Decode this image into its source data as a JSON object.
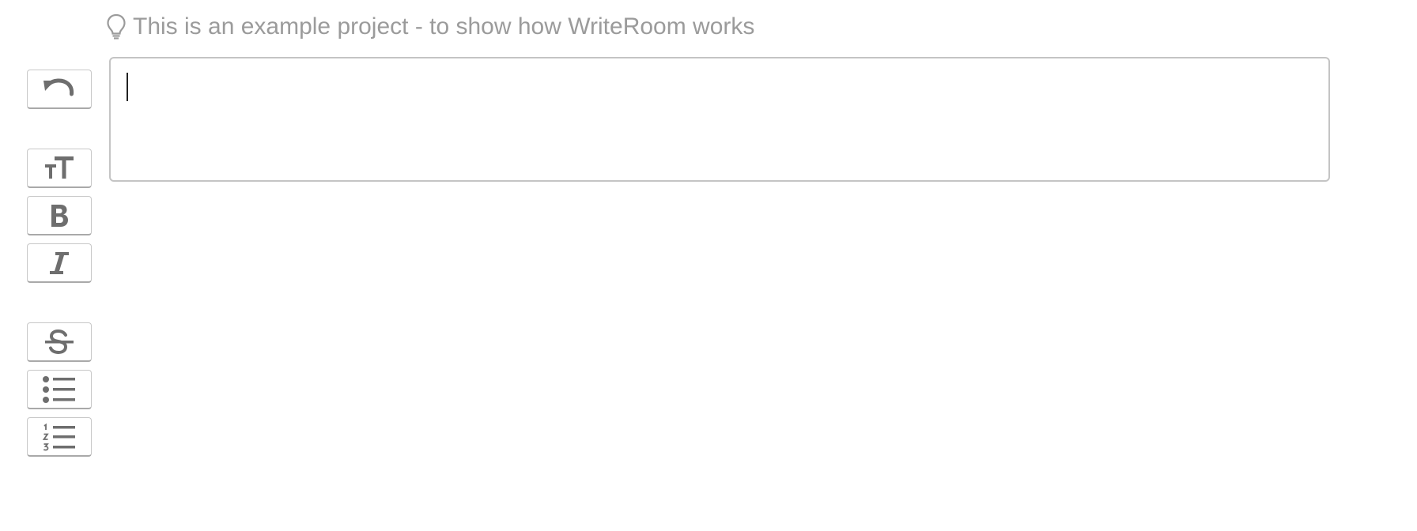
{
  "hint": {
    "icon": "lightbulb-icon",
    "text": "This is an example project - to show how WriteRoom works"
  },
  "editor": {
    "value": ""
  },
  "toolbar": {
    "buttons": [
      {
        "name": "undo-button",
        "icon": "undo-icon"
      },
      {
        "name": "text-size-button",
        "icon": "text-size-icon"
      },
      {
        "name": "bold-button",
        "icon": "bold-icon"
      },
      {
        "name": "italic-button",
        "icon": "italic-icon"
      },
      {
        "name": "strikethrough-button",
        "icon": "strikethrough-icon"
      },
      {
        "name": "bulleted-list-button",
        "icon": "bulleted-list-icon"
      },
      {
        "name": "numbered-list-button",
        "icon": "numbered-list-icon"
      }
    ]
  },
  "colors": {
    "icon": "#6e6e6e",
    "hint_text": "#9b9b9b",
    "border": "#c4c4c4"
  }
}
